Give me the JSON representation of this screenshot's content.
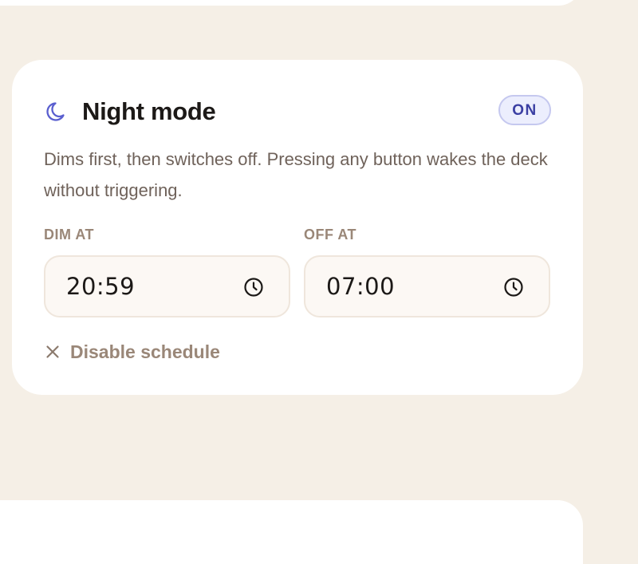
{
  "night_mode": {
    "title": "Night mode",
    "status_badge": "ON",
    "description": "Dims first, then switches off. Pressing any button wakes the deck without triggering.",
    "dim_at": {
      "label": "DIM AT",
      "value": "20:59"
    },
    "off_at": {
      "label": "OFF AT",
      "value": "07:00"
    },
    "disable_link": "Disable schedule"
  },
  "icons": {
    "title_icon": "moon-icon",
    "time_icon": "clock-icon",
    "disable_icon": "x-icon"
  },
  "colors": {
    "page_background": "#f5efe6",
    "card_background": "#ffffff",
    "accent": "#5a5fcf",
    "badge_text": "#3b3fa3",
    "badge_background": "#eceefd",
    "muted_text": "#9a8778"
  }
}
